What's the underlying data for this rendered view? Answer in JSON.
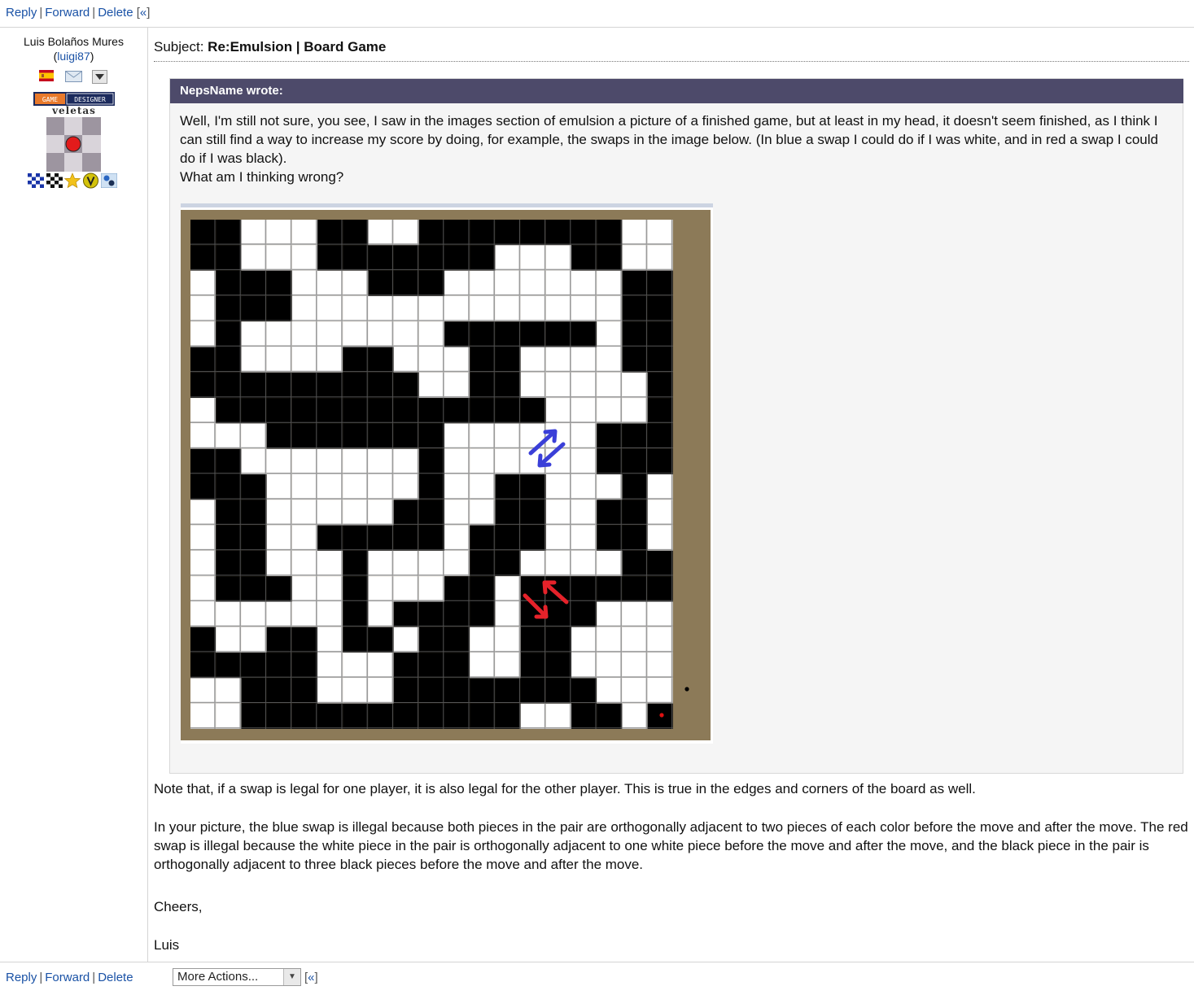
{
  "actions": {
    "reply": "Reply",
    "forward": "Forward",
    "delete": "Delete",
    "collapse": "«"
  },
  "user": {
    "name": "Luis Bolaños Mures",
    "handle": "luigi87",
    "badge_label": "GAME DESIGNER",
    "game_name": "veletas"
  },
  "post": {
    "subject_prefix": "Subject:",
    "subject": "Re:Emulsion | Board Game",
    "quote_author": "NepsName wrote:",
    "quote_text": "Well, I'm still not sure, you see, I saw in the images section of emulsion a picture of a finished game, but at least in my head, it doesn't seem finished, as I think I can still find a way to increase my score by doing, for example, the swaps in the image below. (In blue a swap I could do if I was white, and in red a swap I could do if I was black).",
    "quote_question": "What am I thinking wrong?",
    "para1": "Note that, if a swap is legal for one player, it is also legal for the other player. This is true in the edges and corners of the board as well.",
    "para2": "In your picture, the blue swap is illegal because both pieces in the pair are orthogonally adjacent to two pieces of each color before the move and after the move. The red swap is illegal because the white piece in the pair is orthogonally adjacent to one white piece before the move and after the move, and the black piece in the pair is orthogonally adjacent to three black pieces before the move and after the move.",
    "para3": "Cheers,",
    "signature": "Luis"
  },
  "board": {
    "rows": [
      "BBWWWBBWWBBBBBBBBWW",
      "BBWWWBBBBBBBWWWBBWW",
      "WBBBWWWBBBWWWWWWWBB",
      "WBBBWWWWWWWWWWWWWBB",
      "WBWWWWWWWWBBBBBBWBB",
      "BBWWWWBBWWWBBWWWWBB",
      "BBBBBBBBBWWBBWWWWWB",
      "WBBBBBBBBBBBBBWWWWB",
      "WWWBBBBBBBWWWWWWBBB",
      "BBWWWWWWWBWWWWWWBBB",
      "BBBWWWWWWBWWBBWWWBW",
      "WBBWWWWWBBWWBBWWBBW",
      "WBBWWBBBBBWBBBWWBBW",
      "WBBWWWBWWWWBBWWWWBB",
      "WBBBWWBWWWBBWBBBBBB",
      "WWWWWWBWBBBBWBBBWWW",
      "BWWBBWBBWBBWWBBWWWW",
      "BBBBBWWWBBBWWBBWWWW",
      "WWBBBWWWBBBBBBBBWWW",
      "WWBBBBBBBBBBBWWBBWB"
    ],
    "blue_arrow_color": "#3a3fd8",
    "red_arrow_color": "#e5222a",
    "frame_color": "#8c7a58"
  },
  "menu": {
    "more_actions": "More Actions..."
  },
  "colors": {
    "link": "#1a52a6",
    "quote_header": "#4d4a6a"
  }
}
